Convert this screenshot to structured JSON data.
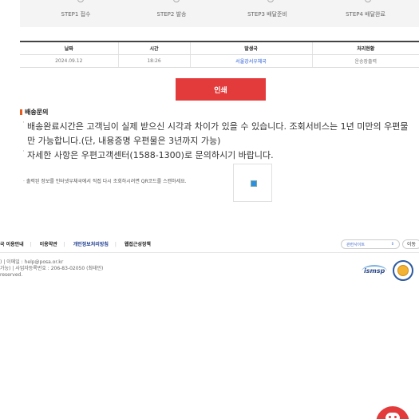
{
  "steps": [
    {
      "label": "STEP1 접수"
    },
    {
      "label": "STEP2 발송"
    },
    {
      "label": "STEP3 배달준비"
    },
    {
      "label": "STEP4 배달완료"
    }
  ],
  "table": {
    "headers": [
      "날짜",
      "시간",
      "발생국",
      "처리현황"
    ],
    "rows": [
      [
        "2024.09.12",
        "18:26",
        "서울강서우체국",
        "운송장출력"
      ]
    ]
  },
  "print_button": "인쇄",
  "inquiry": {
    "title": "배송문의",
    "items": [
      "배송완료시간은 고객님이 실제 받으신 시각과 차이가 있을 수 있습니다. 조회서비스는 1년 미만의 우편물만 가능합니다.(단, 내용증명 우편물은 3년까지 가능)",
      "자세한 사항은 우편고객센터(1588-1300)로 문의하시기 바랍니다."
    ],
    "qr_note": "출력된 정보를 인터넷우체국에서 직접 다시 조회하시려면 QR코드를 스캔하세요."
  },
  "footer": {
    "links": [
      "국 이용안내",
      "이용약관",
      "개인정보처리방침",
      "웹접근성정책"
    ],
    "related_sites": "관련사이트",
    "go": "이동",
    "info_line1": ")  |  이메일 : help@posa.or.kr",
    "info_line2": "가능)  |  사업자등록번호 : 206-83-02050 (최태민)",
    "info_line3": "reserved.",
    "isms": "ismsp"
  },
  "colors": {
    "accent_red": "#e33b3b",
    "link_blue": "#2a5bd7",
    "section_orange": "#e85b1c"
  }
}
